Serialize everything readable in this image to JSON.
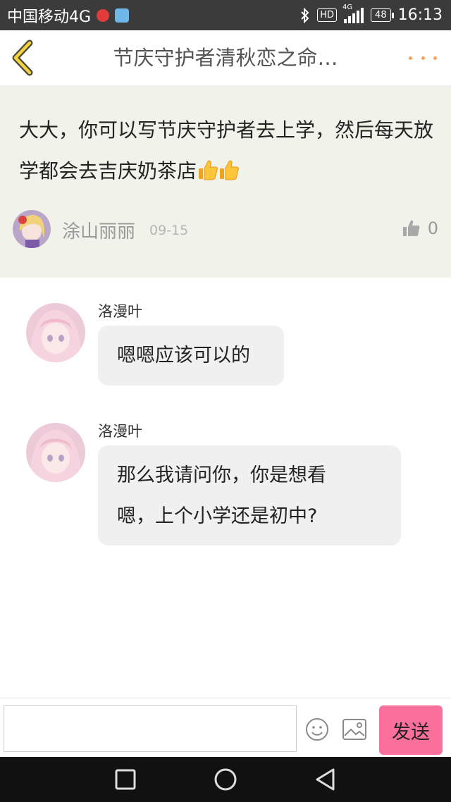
{
  "status_bar": {
    "carrier": "中国移动4G",
    "hd": "HD",
    "network": "4G",
    "battery": "48",
    "time": "16:13"
  },
  "header": {
    "title": "节庆守护者清秋恋之命…",
    "back_icon": "chevron-left-icon",
    "more_icon": "more-dots-icon"
  },
  "post": {
    "text": "大大，你可以写节庆守护者去上学，然后每天放学都会去吉庆奶茶店",
    "emoji": "thumbs-up",
    "author": "涂山丽丽",
    "date": "09-15",
    "likes": "0"
  },
  "replies": [
    {
      "name": "洛漫叶",
      "text": "嗯嗯应该可以的"
    },
    {
      "name": "洛漫叶",
      "text_line1": "那么我请问你，你是想看",
      "text_line2": "嗯，上个小学还是初中?"
    }
  ],
  "input_bar": {
    "placeholder": "",
    "send_label": "发送"
  },
  "colors": {
    "accent": "#f7a25c",
    "send": "#fb6f9c",
    "post_bg": "#f1f3ea"
  }
}
